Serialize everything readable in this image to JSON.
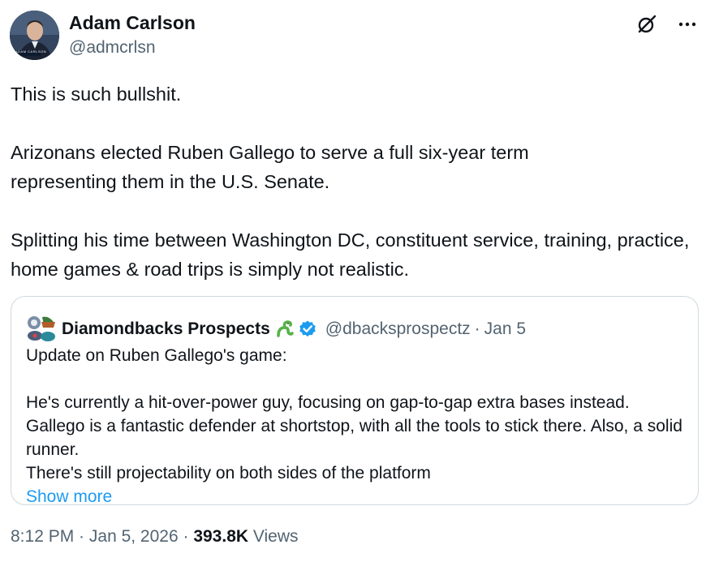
{
  "author": {
    "name": "Adam Carlson",
    "handle": "@admcrlsn",
    "avatar_caption": "ADAM CARLSON"
  },
  "icons": {
    "grok": "grok-icon",
    "more": "more-icon"
  },
  "tweet": {
    "paragraphs": [
      "This is such bullshit.",
      "Arizonans elected Ruben Gallego to serve a full six-year term representing them in the U.S. Senate.",
      "Splitting his time between Washington DC, constituent service, training, practice, home games & road trips is simply not realistic."
    ]
  },
  "quote": {
    "name": "Diamondbacks Prospects",
    "handle": "@dbacksprospectz",
    "separator": "·",
    "date": "Jan 5",
    "text_p1": "Update on Ruben Gallego's game:",
    "text_p2a": "He's currently a hit-over-power guy, focusing on gap-to-gap extra bases instead. Gallego is a fantastic defender at shortstop, with all the tools to stick there. Also, a solid runner.",
    "text_p2b": "There's still projectability on both sides of the platform",
    "show_more": "Show more"
  },
  "footer": {
    "time": "8:12 PM",
    "sep1": " · ",
    "date": "Jan 5, 2026",
    "sep2": " · ",
    "views_count": "393.8K",
    "views_label": " Views"
  },
  "colors": {
    "text": "#0f1419",
    "muted": "#536471",
    "link": "#1d9bf0",
    "border": "#cfd9de",
    "verified": "#1d9bf0"
  }
}
